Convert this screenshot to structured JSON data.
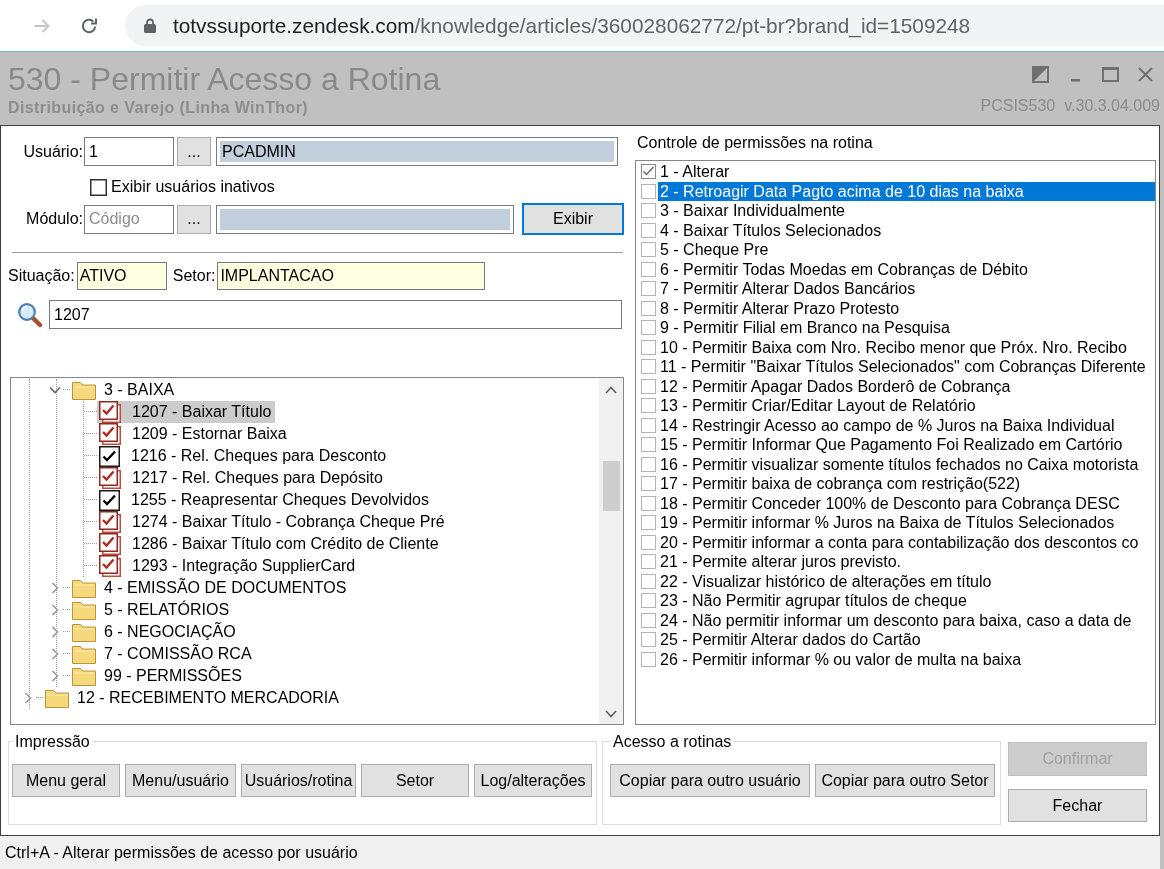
{
  "browser": {
    "url": {
      "host": "totvssuporte.zendesk.com",
      "path": "/knowledge/articles/360028062772/pt-br?brand_id=1509248"
    }
  },
  "window": {
    "title": "530 - Permitir Acesso a Rotina",
    "subtitle": "Distribuição e Varejo (Linha WinThor)",
    "program": "PCSIS530",
    "version": "v.30.3.04.009"
  },
  "form": {
    "user": {
      "label": "Usuário:",
      "code": "1",
      "lookup": "...",
      "name": "PCADMIN"
    },
    "show_inactive": {
      "label": "Exibir usuários inativos",
      "checked": false
    },
    "module": {
      "label": "Módulo:",
      "placeholder": "Código",
      "lookup": "...",
      "show_button": {
        "label": "Exibir",
        "focused": true
      }
    },
    "situation": {
      "label": "Situação:",
      "value": "ATIVO"
    },
    "sector": {
      "label": "Setor:",
      "value": "IMPLANTACAO"
    },
    "search": {
      "value": "1207"
    }
  },
  "tree": {
    "items": [
      {
        "children": [
          {
            "kind": "folder",
            "label": "3 - BAIXA",
            "expanded": true,
            "selected": false,
            "children": [
              {
                "kind": "stacked",
                "label": "1207 - Baixar Título",
                "checked": true,
                "selected": true
              },
              {
                "kind": "stacked",
                "label": "1209 - Estornar Baixa",
                "checked": true,
                "selected": false
              },
              {
                "kind": "plain",
                "label": "1216 - Rel. Cheques para Desconto",
                "checked": true,
                "selected": false
              },
              {
                "kind": "stacked",
                "label": "1217 - Rel. Cheques para Depósito",
                "checked": true,
                "selected": false
              },
              {
                "kind": "plain",
                "label": "1255 - Reapresentar Cheques Devolvidos",
                "checked": true,
                "selected": false
              },
              {
                "kind": "stacked",
                "label": "1274 - Baixar Título - Cobrança Cheque Pré",
                "checked": true,
                "selected": false
              },
              {
                "kind": "stacked",
                "label": "1286 - Baixar Título com Crédito de Cliente",
                "checked": true,
                "selected": false
              },
              {
                "kind": "stacked",
                "label": "1293 - Integração SupplierCard",
                "checked": true,
                "selected": false
              }
            ]
          },
          {
            "kind": "folder",
            "label": "4 - EMISSÃO DE DOCUMENTOS",
            "expanded": false,
            "selected": false
          },
          {
            "kind": "folder",
            "label": "5 - RELATÓRIOS",
            "expanded": false,
            "selected": false
          },
          {
            "kind": "folder",
            "label": "6 - NEGOCIAÇÃO",
            "expanded": false,
            "selected": false
          },
          {
            "kind": "folder",
            "label": "7 - COMISSÃO RCA",
            "expanded": false,
            "selected": false
          },
          {
            "kind": "folder",
            "label": "99 - PERMISSÕES",
            "expanded": false,
            "selected": false
          }
        ]
      },
      {
        "kind": "folder",
        "label": "12 - RECEBIMENTO MERCADORIA",
        "expanded": false,
        "selected": false
      }
    ]
  },
  "permissions": {
    "title": "Controle de permissões na rotina",
    "items": [
      {
        "label": "1 - Alterar",
        "checked": true,
        "selected": false
      },
      {
        "label": "2 - Retroagir Data Pagto acima de 10 dias na baixa",
        "checked": false,
        "selected": true
      },
      {
        "label": "3 - Baixar Individualmente",
        "checked": false,
        "selected": false
      },
      {
        "label": "4 - Baixar Títulos Selecionados",
        "checked": false,
        "selected": false
      },
      {
        "label": "5 - Cheque Pre",
        "checked": false,
        "selected": false
      },
      {
        "label": "6 - Permitir Todas Moedas em Cobranças de Débito",
        "checked": false,
        "selected": false
      },
      {
        "label": "7 - Permitir Alterar Dados Bancários",
        "checked": false,
        "selected": false
      },
      {
        "label": "8 - Permitir Alterar Prazo Protesto",
        "checked": false,
        "selected": false
      },
      {
        "label": "9 - Permitir Filial em Branco na Pesquisa",
        "checked": false,
        "selected": false
      },
      {
        "label": "10 - Permitir Baixa com Nro. Recibo menor que Próx. Nro. Recibo",
        "checked": false,
        "selected": false
      },
      {
        "label": "11 - Permitir \"Baixar Títulos Selecionados\" com Cobranças Diferente",
        "checked": false,
        "selected": false
      },
      {
        "label": "12 - Permitir Apagar Dados Borderô de Cobrança",
        "checked": false,
        "selected": false
      },
      {
        "label": "13 - Permitir Criar/Editar Layout de Relatório",
        "checked": false,
        "selected": false
      },
      {
        "label": "14 - Restringir Acesso ao campo de % Juros na Baixa Individual",
        "checked": false,
        "selected": false
      },
      {
        "label": "15 - Permitir Informar Que Pagamento Foi Realizado em Cartório",
        "checked": false,
        "selected": false
      },
      {
        "label": "16 - Permitir visualizar somente títulos fechados no Caixa motorista",
        "checked": false,
        "selected": false
      },
      {
        "label": "17 - Permitir baixa de cobrança com restrição(522)",
        "checked": false,
        "selected": false
      },
      {
        "label": "18 - Permitir Conceder 100% de Desconto para Cobrança DESC",
        "checked": false,
        "selected": false
      },
      {
        "label": "19 - Permitir informar % Juros na Baixa de Títulos Selecionados",
        "checked": false,
        "selected": false
      },
      {
        "label": "20 - Permitir informar a conta para contabilização dos descontos co",
        "checked": false,
        "selected": false
      },
      {
        "label": "21 - Permite alterar juros previsto.",
        "checked": false,
        "selected": false
      },
      {
        "label": "22 - Visualizar histórico de alterações em título",
        "checked": false,
        "selected": false
      },
      {
        "label": "23 - Não Permitir agrupar títulos de cheque",
        "checked": false,
        "selected": false
      },
      {
        "label": "24 - Não permitir informar um desconto para baixa, caso a data de",
        "checked": false,
        "selected": false
      },
      {
        "label": "25 - Permitir Alterar dados do Cartão",
        "checked": false,
        "selected": false
      },
      {
        "label": "26 - Permitir informar % ou valor de multa na baixa",
        "checked": false,
        "selected": false
      }
    ]
  },
  "print_group": {
    "title": "Impressão",
    "buttons": [
      "Menu geral",
      "Menu/usuário",
      "Usuários/rotina",
      "Setor",
      "Log/alterações"
    ]
  },
  "access_group": {
    "title": "Acesso a rotinas",
    "buttons": [
      "Copiar para outro usuário",
      "Copiar para outro Setor"
    ]
  },
  "actions": [
    {
      "label": "Confirmar",
      "disabled": true
    },
    {
      "label": "Fechar",
      "disabled": false
    }
  ],
  "status_bar": {
    "text": "Ctrl+A - Alterar permissões de acesso por usuário"
  }
}
